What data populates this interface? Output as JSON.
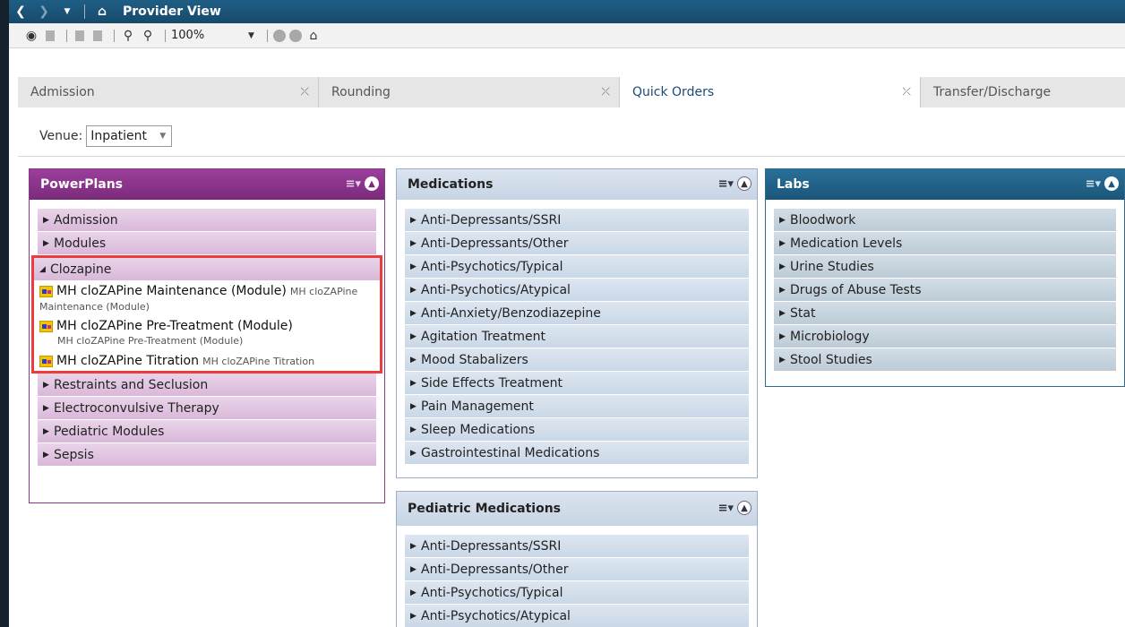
{
  "titlebar": {
    "title": "Provider View",
    "icons": [
      "back-icon",
      "forward-icon",
      "dropdown-icon",
      "home-icon"
    ]
  },
  "toolbar": {
    "zoom": "100%",
    "icons": [
      "binoculars-icon",
      "document-icon",
      "print-icon",
      "zoom-out-icon",
      "zoom-in-icon",
      "home-icon"
    ]
  },
  "tabs": [
    {
      "label": "Admission"
    },
    {
      "label": "Rounding"
    },
    {
      "label": "Quick Orders",
      "active": true
    },
    {
      "label": "Transfer/Discharge"
    }
  ],
  "venue": {
    "label": "Venue:",
    "value": "Inpatient"
  },
  "powerplans": {
    "title": "PowerPlans",
    "items_before": [
      "Admission",
      "Modules"
    ],
    "expanded_group": "Clozapine",
    "plans": [
      {
        "name": "MH cloZAPine Maintenance (Module)",
        "sub": "MH cloZAPine Maintenance (Module)"
      },
      {
        "name": "MH cloZAPine Pre-Treatment (Module)",
        "sub": "MH cloZAPine Pre-Treatment (Module)"
      },
      {
        "name": "MH cloZAPine Titration",
        "sub": "MH cloZAPine Titration"
      }
    ],
    "items_after": [
      "Restraints and Seclusion",
      "Electroconvulsive Therapy",
      "Pediatric Modules",
      "Sepsis"
    ]
  },
  "medications": {
    "title": "Medications",
    "items": [
      "Anti-Depressants/SSRI",
      "Anti-Depressants/Other",
      "Anti-Psychotics/Typical",
      "Anti-Psychotics/Atypical",
      "Anti-Anxiety/Benzodiazepine",
      "Agitation Treatment",
      "Mood Stabalizers",
      "Side Effects Treatment",
      "Pain Management",
      "Sleep Medications",
      "Gastrointestinal Medications"
    ]
  },
  "labs": {
    "title": "Labs",
    "items": [
      "Bloodwork",
      "Medication Levels",
      "Urine Studies",
      "Drugs of Abuse Tests",
      "Stat",
      "Microbiology",
      "Stool Studies"
    ]
  },
  "pediatric_medications": {
    "title": "Pediatric Medications",
    "items": [
      "Anti-Depressants/SSRI",
      "Anti-Depressants/Other",
      "Anti-Psychotics/Typical",
      "Anti-Psychotics/Atypical"
    ]
  },
  "colors": {
    "titlebar": "#1f5e85",
    "powerplans_header": "#8b3a8b",
    "labs_header": "#2a6f97",
    "highlight_box": "#ee3b3b"
  }
}
